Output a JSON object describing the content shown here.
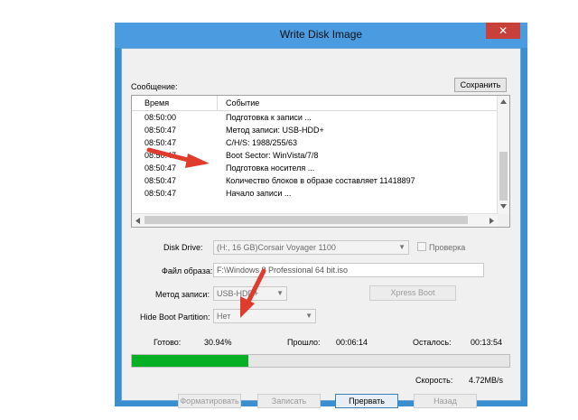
{
  "window": {
    "title": "Write Disk Image",
    "close_label": "✕"
  },
  "log": {
    "label": "Сообщение:",
    "save_button": "Сохранить",
    "columns": [
      "Время",
      "Событие"
    ],
    "rows": [
      {
        "time": "08:50:00",
        "event": "Подготовка к записи ..."
      },
      {
        "time": "08:50:47",
        "event": "Метод записи: USB-HDD+"
      },
      {
        "time": "08:50:47",
        "event": "C/H/S: 1988/255/63"
      },
      {
        "time": "08:50:47",
        "event": "Boot Sector: WinVista/7/8"
      },
      {
        "time": "08:50:47",
        "event": "Подготовка носителя ..."
      },
      {
        "time": "08:50:47",
        "event": "Количество блоков в образе составляет 11418897"
      },
      {
        "time": "08:50:47",
        "event": "Начало записи ..."
      }
    ]
  },
  "form": {
    "disk_drive_label": "Disk Drive:",
    "disk_drive_value": "(H:, 16 GB)Corsair Voyager        1100",
    "verify_label": "Проверка",
    "image_file_label": "Файл образа:",
    "image_file_value": "F:\\Windows 8 Professional 64 bit.iso",
    "write_method_label": "Метод записи:",
    "write_method_value": "USB-HDD+",
    "xpress_boot": "Xpress Boot",
    "hide_boot_label": "Hide Boot Partition:",
    "hide_boot_value": "Нет"
  },
  "status": {
    "done_label": "Готово:",
    "done_value": "30.94%",
    "elapsed_label": "Прошло:",
    "elapsed_value": "00:06:14",
    "remaining_label": "Осталось:",
    "remaining_value": "00:13:54",
    "speed_label": "Скорость:",
    "speed_value": "4.72MB/s",
    "progress_fraction": 0.3094
  },
  "buttons": {
    "format": "Форматировать",
    "write": "Записать",
    "abort": "Прервать",
    "back": "Назад"
  },
  "colors": {
    "progress_fill": "#06b025",
    "annotation_arrow": "#e03c2e"
  }
}
